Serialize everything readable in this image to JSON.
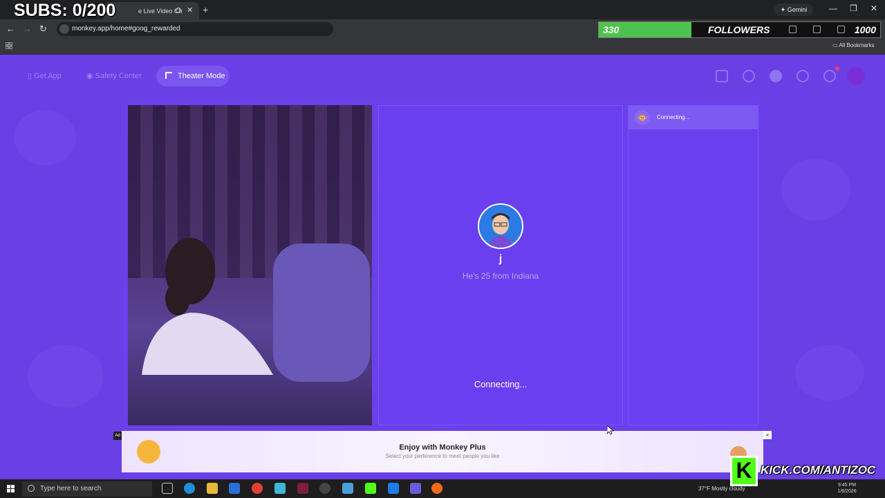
{
  "browser": {
    "tab_title": "e Live Video Ch",
    "new_tab": "+",
    "gemini_label": "Gemini",
    "url": "monkey.app/home#goog_rewarded",
    "bookmarks_label": "All Bookmarks"
  },
  "overlay": {
    "subs_text": "SUBS: 0/200",
    "followers_current": "330",
    "followers_label": "FOLLOWERS",
    "followers_goal": "1000",
    "followers_progress": 0.33,
    "kick_text": "KICK.COM/ANTIZOC",
    "kick_logo": "K"
  },
  "app": {
    "nav": {
      "get_app": "Get App",
      "safety_center": "Safety Center",
      "theater_mode": "Theater Mode"
    },
    "peer": {
      "name": "j",
      "subtitle": "He's 25 from Indiana",
      "status": "Connecting..."
    },
    "chat": {
      "header": "Connecting..."
    },
    "ad": {
      "badge": "Ad",
      "title": "Enjoy with Monkey Plus",
      "subtitle": "Select your perference to meet people you like",
      "close": "×"
    }
  },
  "taskbar": {
    "search_placeholder": "Type here to search",
    "weather": "37°F  Mostly cloudy",
    "time": "9:45 PM",
    "date": "1/6/2026"
  },
  "colors": {
    "page_bg": "#6b3fe6",
    "accent_green": "#4ec24e",
    "kick_green": "#53fc18"
  }
}
